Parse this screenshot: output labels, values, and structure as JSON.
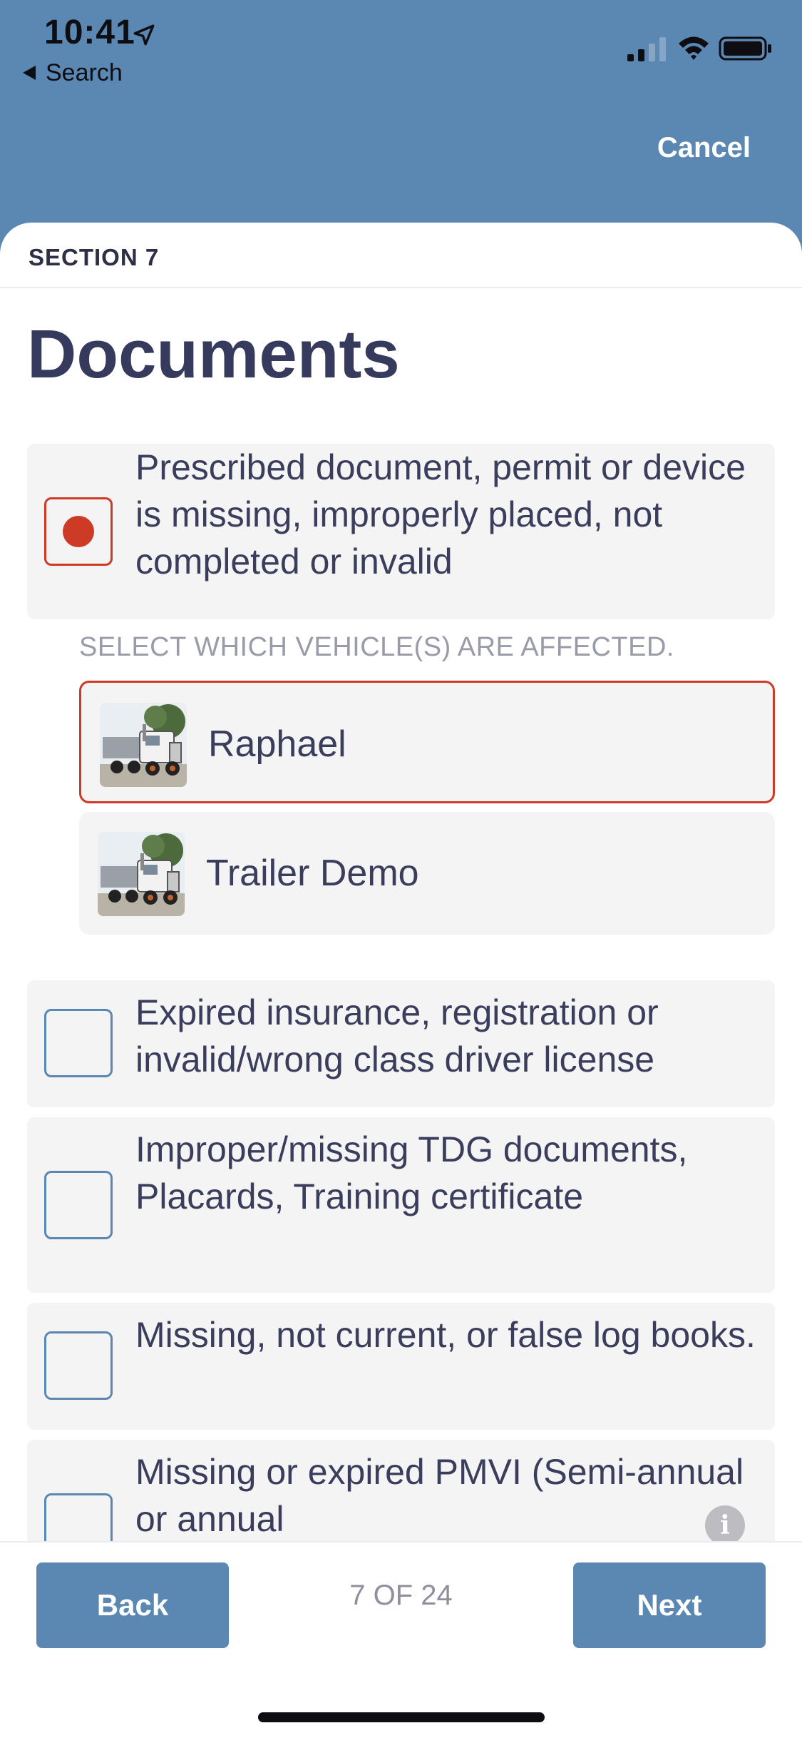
{
  "status_bar": {
    "time": "10:41",
    "back_label": "Search"
  },
  "header": {
    "cancel_label": "Cancel"
  },
  "section": {
    "label": "SECTION 7",
    "title": "Documents"
  },
  "options": [
    {
      "text": "Prescribed document, permit or device is missing, improperly placed, not completed or invalid",
      "checked": true
    },
    {
      "text": "Expired insurance, registration or invalid/wrong class driver license",
      "checked": false
    },
    {
      "text": "Improper/missing TDG documents, Placards, Training certificate",
      "checked": false
    },
    {
      "text": "Missing, not current, or false log books.",
      "checked": false
    },
    {
      "text": "Missing or expired PMVI (Semi-annual or annual",
      "checked": false
    }
  ],
  "vehicle_selection": {
    "hint": "SELECT WHICH VEHICLE(S) ARE AFFECTED.",
    "vehicles": [
      {
        "name": "Raphael",
        "selected": true
      },
      {
        "name": "Trailer Demo",
        "selected": false
      }
    ]
  },
  "footer": {
    "back_label": "Back",
    "next_label": "Next",
    "page_indicator": "7 OF 24"
  },
  "colors": {
    "accent": "#5b87b3",
    "selected": "#cd3b26",
    "title_text": "#363a5c"
  }
}
